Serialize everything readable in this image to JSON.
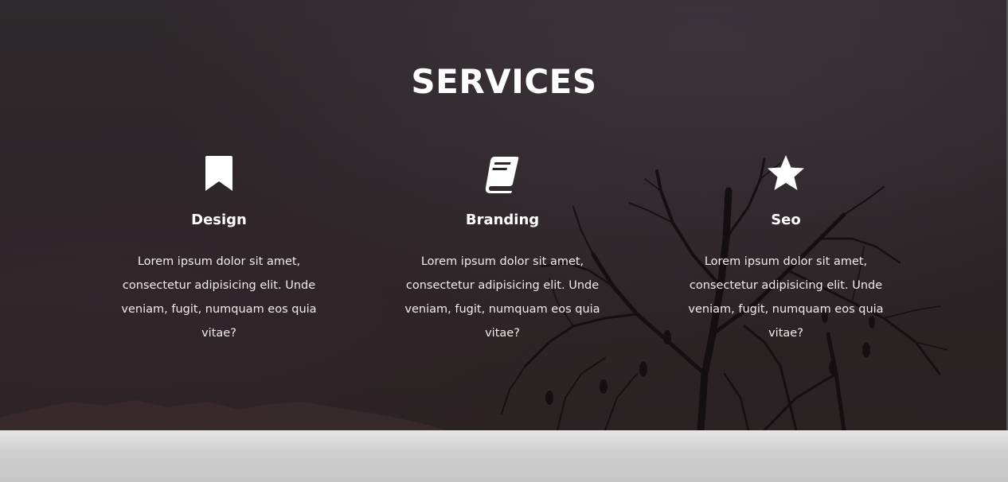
{
  "section": {
    "title": "SERVICES"
  },
  "services": [
    {
      "icon": "bookmark-icon",
      "title": "Design",
      "text": "Lorem ipsum dolor sit amet, consectetur adipisicing elit. Unde veniam, fugit, numquam eos quia vitae?"
    },
    {
      "icon": "book-icon",
      "title": "Branding",
      "text": "Lorem ipsum dolor sit amet, consectetur adipisicing elit. Unde veniam, fugit, numquam eos quia vitae?"
    },
    {
      "icon": "star-icon",
      "title": "Seo",
      "text": "Lorem ipsum dolor sit amet, consectetur adipisicing elit. Unde veniam, fugit, numquam eos quia vitae?"
    }
  ],
  "colors": {
    "overlay": "#2b2426",
    "text": "#ffffff",
    "footer": "#cfcfcf"
  }
}
